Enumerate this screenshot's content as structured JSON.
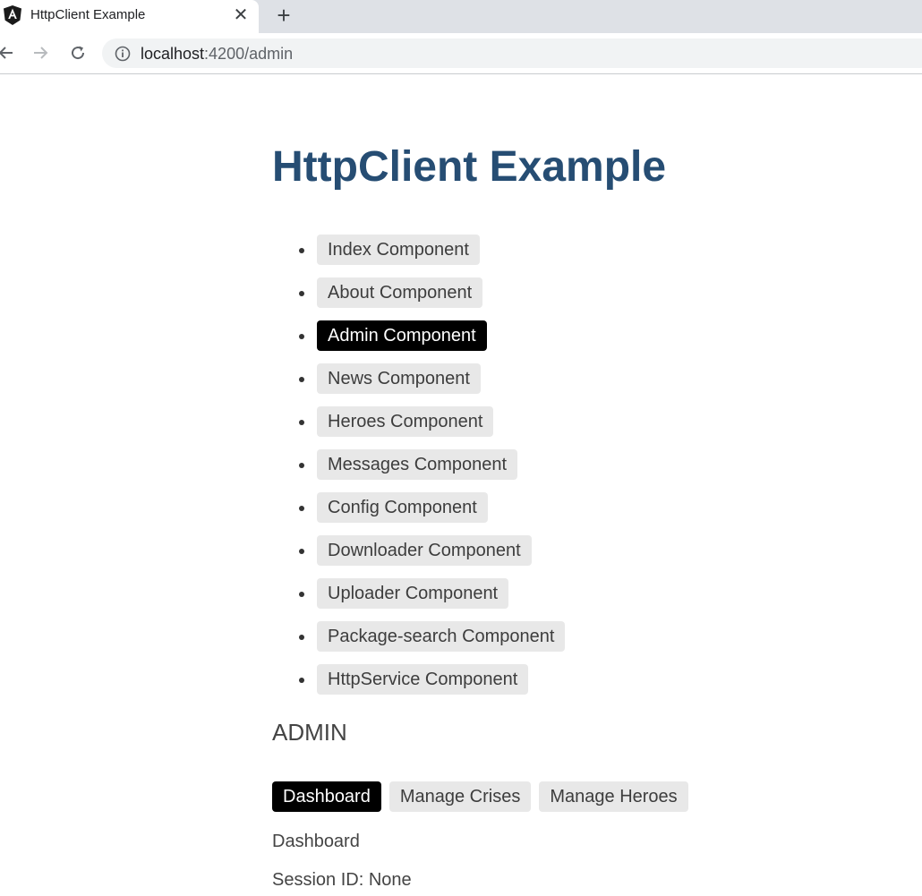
{
  "browser": {
    "tab": {
      "title": "HttpClient Example",
      "close_glyph": "✕",
      "favicon": "angular-logo-icon"
    },
    "new_tab_glyph": "+",
    "url": {
      "host": "localhost",
      "rest": ":4200/admin"
    }
  },
  "page": {
    "title": "HttpClient Example",
    "nav": [
      {
        "label": "Index Component",
        "active": false
      },
      {
        "label": "About Component",
        "active": false
      },
      {
        "label": "Admin Component",
        "active": true
      },
      {
        "label": "News Component",
        "active": false
      },
      {
        "label": "Heroes Component",
        "active": false
      },
      {
        "label": "Messages Component",
        "active": false
      },
      {
        "label": "Config Component",
        "active": false
      },
      {
        "label": "Downloader Component",
        "active": false
      },
      {
        "label": "Uploader Component",
        "active": false
      },
      {
        "label": "Package-search Component",
        "active": false
      },
      {
        "label": "HttpService Component",
        "active": false
      }
    ],
    "admin": {
      "heading": "ADMIN",
      "nav": [
        {
          "label": "Dashboard",
          "active": true
        },
        {
          "label": "Manage Crises",
          "active": false
        },
        {
          "label": "Manage Heroes",
          "active": false
        }
      ],
      "dashboard_text": "Dashboard",
      "session_text": "Session ID: None"
    }
  },
  "colors": {
    "title": "#264d73",
    "button_bg": "#e8e8e8",
    "button_active_bg": "#000000",
    "button_active_text": "#ffffff"
  }
}
